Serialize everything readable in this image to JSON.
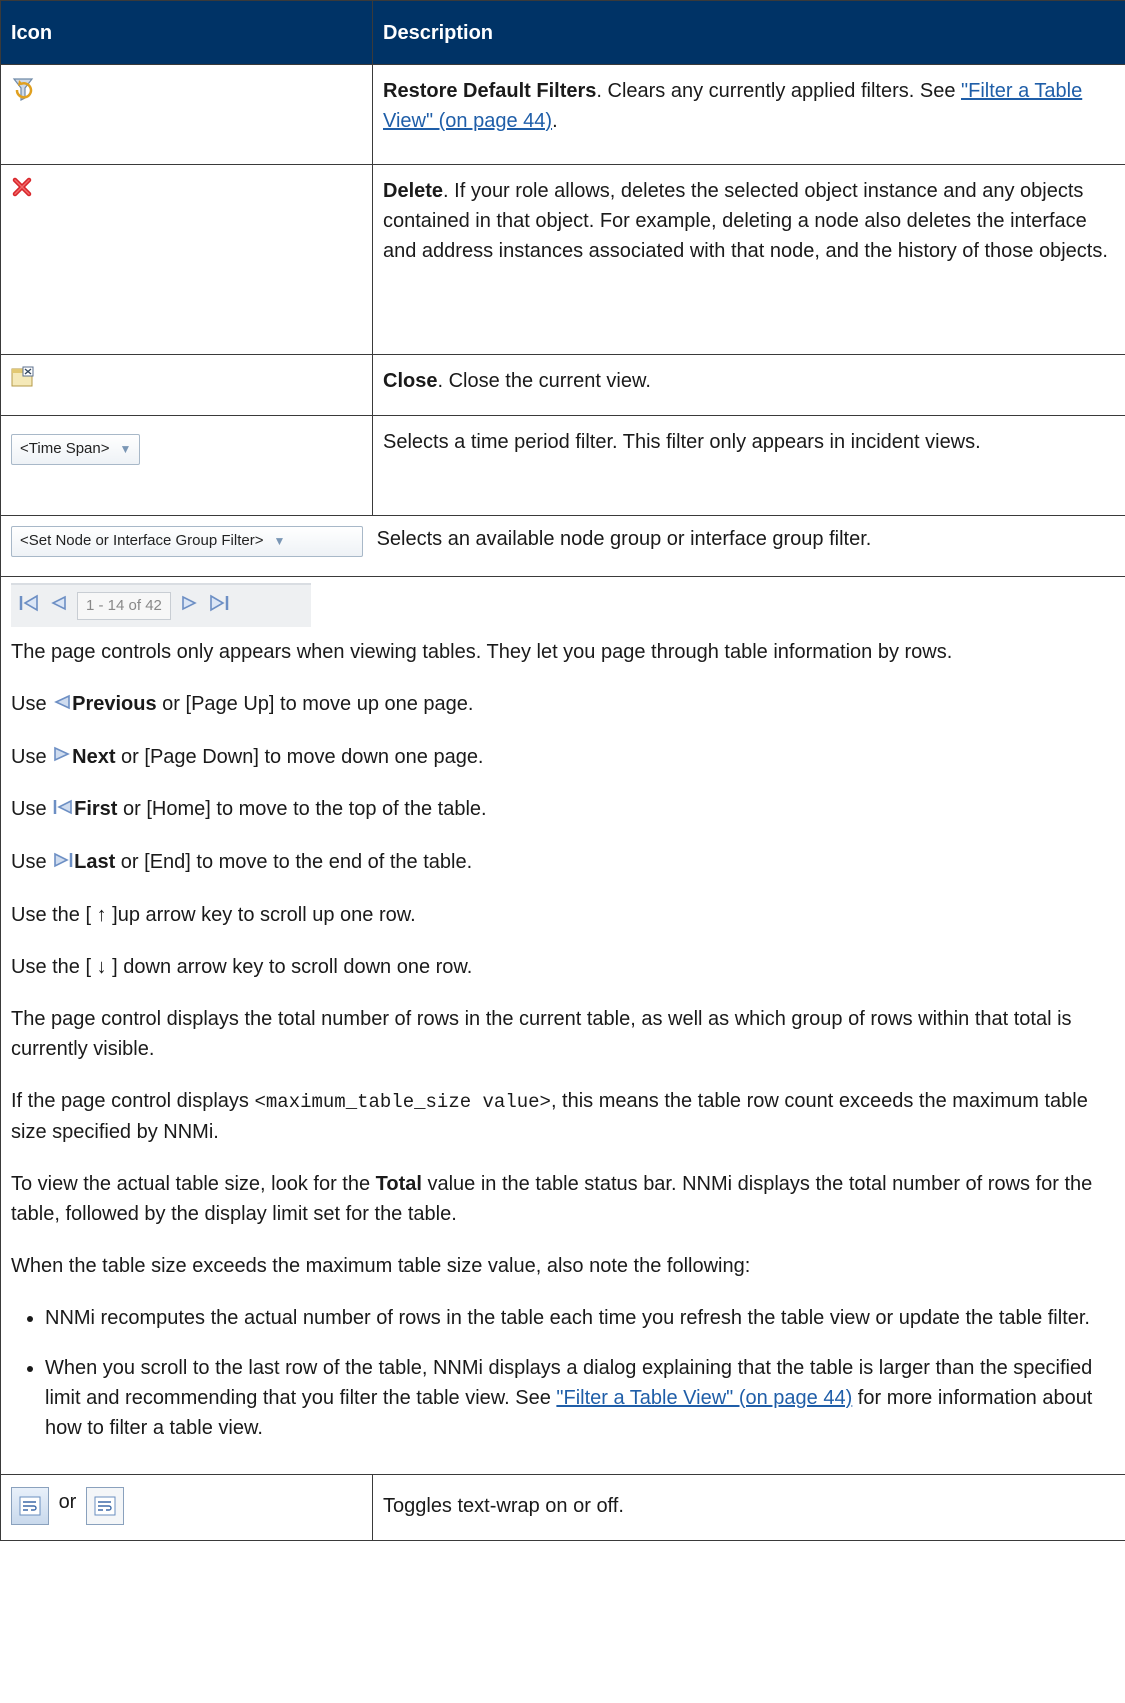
{
  "header": {
    "col_icon": "Icon",
    "col_description": "Description"
  },
  "rows": {
    "restore": {
      "icon": "restore-filters-icon",
      "title": "Restore Default Filters",
      "text": ". Clears any currently applied filters. See ",
      "link": "\"Filter a Table View\" (on page 44)",
      "after": "."
    },
    "delete": {
      "icon": "delete-x-icon",
      "title": "Delete",
      "text": ". If your role allows, deletes the selected object instance and any objects contained in that object. For example, deleting a node also deletes the interface and address instances associated with that node, and the history of those objects."
    },
    "close": {
      "icon": "close-view-icon",
      "title": "Close",
      "text": ". Close the current view."
    },
    "timespan": {
      "control_label": "<Time Span>",
      "text": "Selects a time period filter. This filter only appears in incident views."
    },
    "groupfilter": {
      "control_label": "<Set Node or Interface Group Filter>",
      "text": "Selects an available node group or interface group filter."
    },
    "paging": {
      "pager_value": "1 - 14 of 42",
      "p1": "The page controls only appears when viewing tables. They let you page through table information by rows.",
      "use": "Use ",
      "prev_title": "Previous",
      "prev_text": " or [Page Up] to move up one page.",
      "next_title": "Next",
      "next_text": " or [Page Down] to move down one page.",
      "first_title": "First",
      "first_text": " or [Home] to move to the top of the table.",
      "last_title": "Last",
      "last_text": " or [End] to move to the end of the table.",
      "up_row": "Use the [ ↑ ]up arrow key to scroll up one row.",
      "down_row": "Use the [ ↓ ] down arrow key to scroll down one row.",
      "p_total": "The page control displays the total number of rows in the current table, as well as which group of rows within that total is currently visible.",
      "p_max_a": "If the page control displays ",
      "p_max_code": "<maximum_table_size value>",
      "p_max_b": ", this means the table row count exceeds the maximum table size specified by NNMi.",
      "p_view_a": "To view the actual table size, look for the ",
      "p_view_bold": "Total",
      "p_view_b": " value in the table status bar. NNMi displays the total number of rows for the table, followed by the display limit set for the table.",
      "p_when": "When the table size exceeds the maximum table size value, also note the following:",
      "bullet1": "NNMi recomputes the actual number of rows in the table each time you refresh the table view or update the table filter.",
      "bullet2_a": "When you scroll to the last row of the table, NNMi displays a dialog explaining that the table is larger than the specified limit and recommending that you filter the table view. See ",
      "bullet2_link": "\"Filter a Table View\" (on page 44)",
      "bullet2_b": " for more information about how to filter a table view."
    },
    "wrap": {
      "or": "or",
      "text": "Toggles text-wrap on or off."
    }
  }
}
